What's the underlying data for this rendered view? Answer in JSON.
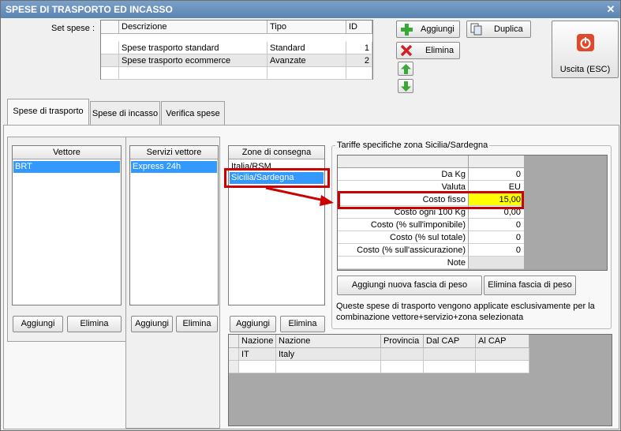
{
  "window": {
    "title": "SPESE DI TRASPORTO ED INCASSO",
    "close_glyph": "✕"
  },
  "set_spese": {
    "label": "Set spese :",
    "columns": [
      "Descrizione",
      "Tipo",
      "ID"
    ],
    "rows": [
      {
        "descrizione": "Spese trasporto standard",
        "tipo": "Standard",
        "id": "1"
      },
      {
        "descrizione": "Spese trasporto ecommerce",
        "tipo": "Avanzate",
        "id": "2"
      }
    ]
  },
  "toolbar": {
    "aggiungi": "Aggiungi",
    "duplica": "Duplica",
    "elimina": "Elimina",
    "uscita": "Uscita (ESC)"
  },
  "tabs": [
    "Spese di trasporto",
    "Spese di incasso",
    "Verifica spese"
  ],
  "vettore": {
    "header": "Vettore",
    "items": [
      "BRT"
    ],
    "add": "Aggiungi",
    "delete": "Elimina"
  },
  "servizi": {
    "header": "Servizi vettore",
    "items": [
      "Express 24h"
    ],
    "add": "Aggiungi",
    "delete": "Elimina"
  },
  "zone": {
    "header": "Zone di consegna",
    "items": [
      "Italia/RSM",
      "Sicilia/Sardegna"
    ],
    "add": "Aggiungi",
    "delete": "Elimina"
  },
  "tariffe": {
    "title": "Tariffe specifiche zona Sicilia/Sardegna",
    "rows": [
      {
        "label": "Da Kg",
        "value": "0"
      },
      {
        "label": "Valuta",
        "value": "EU"
      },
      {
        "label": "Costo fisso",
        "value": "15,00"
      },
      {
        "label": "Costo ogni 100 Kg",
        "value": "0,00"
      },
      {
        "label": "Costo (% sull'imponibile)",
        "value": "0"
      },
      {
        "label": "Costo (% sul totale)",
        "value": "0"
      },
      {
        "label": "Costo (% sull'assicurazione)",
        "value": "0"
      },
      {
        "label": "Note",
        "value": ""
      }
    ],
    "add_fascia": "Aggiungi nuova fascia di peso",
    "del_fascia": "Elimina fascia di peso",
    "info": "Queste spese di trasporto vengono applicate esclusivamente per la combinazione vettore+servizio+zona selezionata"
  },
  "nazioni": {
    "columns": [
      "Nazione",
      "Nazione",
      "Provincia",
      "Dal CAP",
      "Al CAP"
    ],
    "rows": [
      {
        "code": "IT",
        "name": "Italy",
        "provincia": "",
        "dal": "",
        "al": ""
      }
    ]
  },
  "colors": {
    "highlight_red": "#cc0000",
    "yellow": "#ffff00",
    "selection": "#3399ff"
  }
}
